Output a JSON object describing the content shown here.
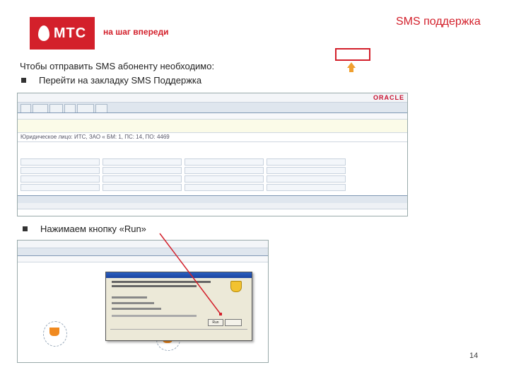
{
  "header": {
    "logo_text": "МТС",
    "slogan": "на шаг впереди",
    "title": "SMS поддержка",
    "brand_color": "#d3202b"
  },
  "instructions": {
    "intro": "Чтобы отправить SMS абоненту необходимо:",
    "step1": "Перейти на закладку SMS Поддержка",
    "step2": "Нажимаем кнопку «Run»"
  },
  "screenshot1": {
    "brand": "ORACLE",
    "account_line": "Юридическое лицо: ИТС, ЗАО « БМ: 1, ПС: 14, ПО: 4469"
  },
  "screenshot2": {
    "run_label": "Run"
  },
  "footer": {
    "page_number": "14"
  }
}
